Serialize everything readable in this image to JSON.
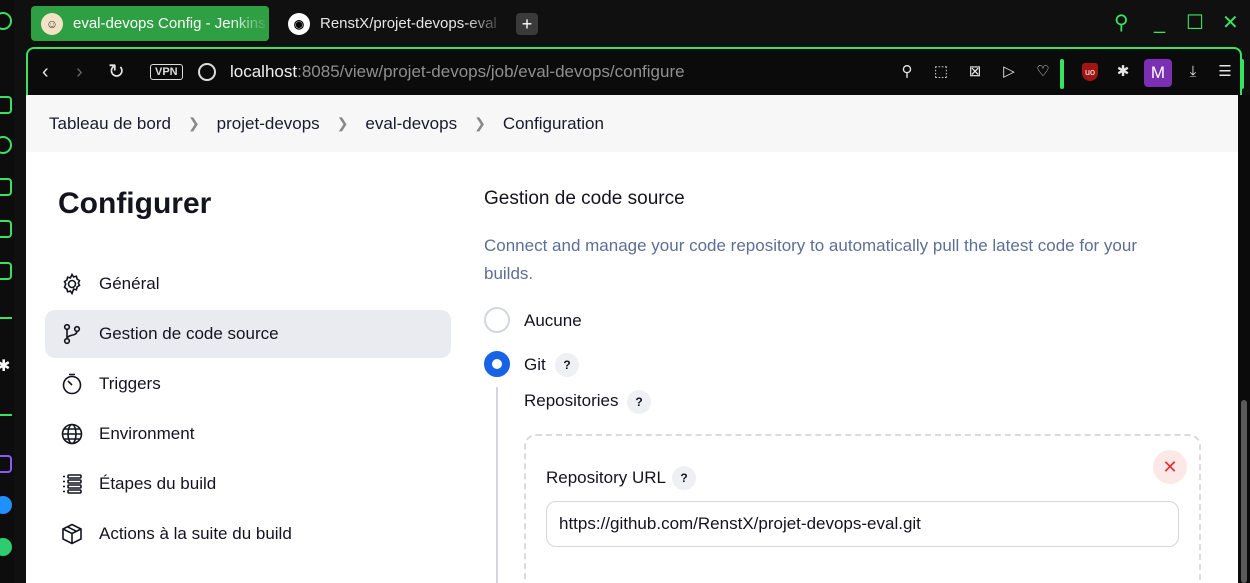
{
  "browser": {
    "tabs": [
      {
        "title": "eval-devops Config - Jenkins",
        "active": true
      },
      {
        "title": "RenstX/projet-devops-eval",
        "active": false
      }
    ],
    "new_tab": "+",
    "vpn_badge": "VPN",
    "url_host": "localhost",
    "url_rest": ":8085/view/projet-devops/job/eval-devops/configure",
    "profile_letter": "M",
    "accent_color": "#37e35f"
  },
  "breadcrumbs": [
    "Tableau de bord",
    "projet-devops",
    "eval-devops",
    "Configuration"
  ],
  "sidebar": {
    "title": "Configurer",
    "items": [
      {
        "label": "Général",
        "icon": "gear-icon"
      },
      {
        "label": "Gestion de code source",
        "icon": "branch-icon",
        "active": true
      },
      {
        "label": "Triggers",
        "icon": "timer-icon"
      },
      {
        "label": "Environment",
        "icon": "globe-icon"
      },
      {
        "label": "Étapes du build",
        "icon": "list-icon"
      },
      {
        "label": "Actions à la suite du build",
        "icon": "package-icon"
      }
    ]
  },
  "scm": {
    "title": "Gestion de code source",
    "description": "Connect and manage your code repository to automatically pull the latest code for your builds.",
    "options": [
      {
        "label": "Aucune",
        "checked": false
      },
      {
        "label": "Git",
        "checked": true
      }
    ],
    "help": "?",
    "repositories_label": "Repositories",
    "repository_url_label": "Repository URL",
    "repository_url_value": "https://github.com/RenstX/projet-devops-eval.git",
    "delete_symbol": "✕"
  }
}
